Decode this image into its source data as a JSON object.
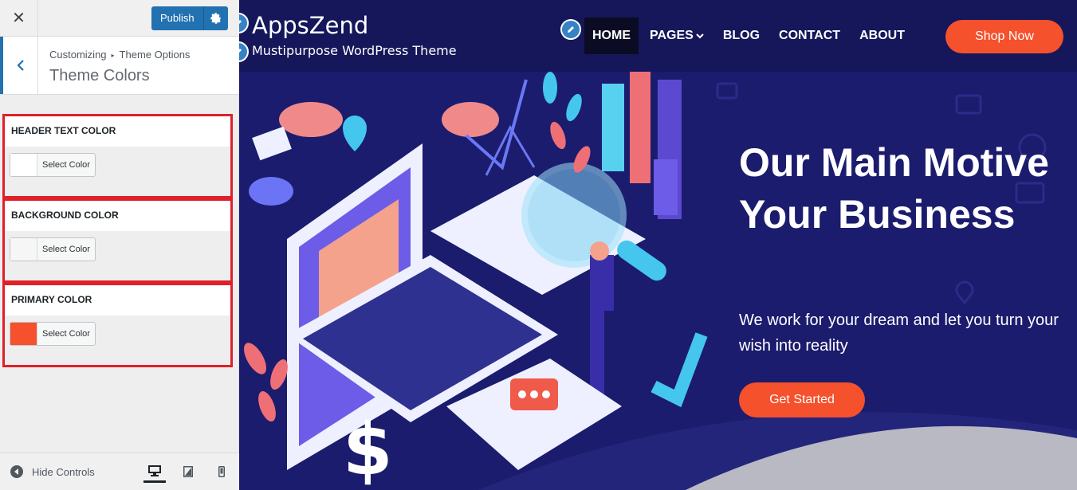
{
  "customizer": {
    "close_icon": "close-icon",
    "publish_label": "Publish",
    "settings_icon": "gear-icon",
    "breadcrumb": [
      "Customizing",
      "Theme Options"
    ],
    "section_title": "Theme Colors",
    "controls": [
      {
        "title": "HEADER TEXT COLOR",
        "button": "Select Color",
        "swatch": "#ffffff"
      },
      {
        "title": "BACKGROUND COLOR",
        "button": "Select Color",
        "swatch": "#f6f6f6"
      },
      {
        "title": "PRIMARY COLOR",
        "button": "Select Color",
        "swatch": "#f4512c"
      }
    ],
    "footer": {
      "hide_controls": "Hide Controls",
      "devices": [
        "desktop-icon",
        "tablet-icon",
        "mobile-icon"
      ]
    }
  },
  "site": {
    "title": "AppsZend",
    "tagline": "Mustipurpose WordPress Theme",
    "nav": [
      {
        "label": "HOME",
        "active": true
      },
      {
        "label": "PAGES",
        "dropdown": true
      },
      {
        "label": "BLOG"
      },
      {
        "label": "CONTACT"
      },
      {
        "label": "ABOUT"
      }
    ],
    "shop_button": "Shop Now",
    "hero": {
      "title": "Our Main Motive Your Business",
      "subtitle": "We work for your dream and let you turn your wish into reality",
      "cta": "Get Started"
    }
  },
  "colors": {
    "accent": "#f4512c",
    "wp_blue": "#2271b1",
    "hero_bg": "#1b1c6e",
    "header_bg": "#15175a",
    "highlight_border": "#e0202a"
  }
}
